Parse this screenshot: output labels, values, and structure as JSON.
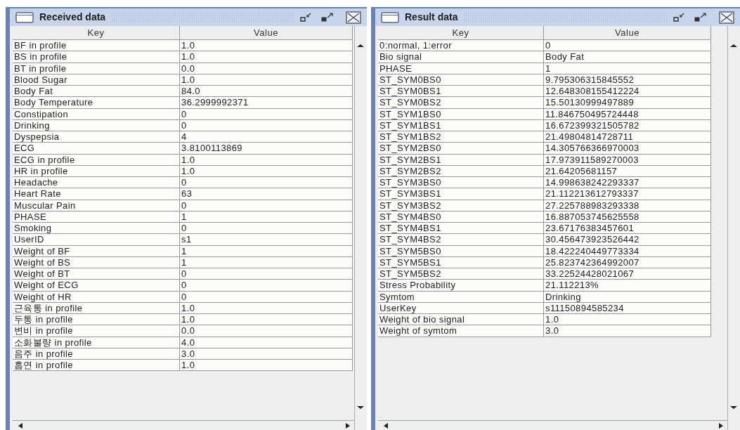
{
  "windows": [
    {
      "title": "Received data",
      "columns": [
        "Key",
        "Value"
      ],
      "rows": [
        {
          "key": "BF in profile",
          "value": "1.0"
        },
        {
          "key": "BS in profile",
          "value": "1.0"
        },
        {
          "key": "BT in profile",
          "value": "0.0"
        },
        {
          "key": "Blood Sugar",
          "value": "1.0"
        },
        {
          "key": "Body Fat",
          "value": "84.0"
        },
        {
          "key": "Body Temperature",
          "value": "36.2999992371"
        },
        {
          "key": "Constipation",
          "value": "0"
        },
        {
          "key": "Drinking",
          "value": "0"
        },
        {
          "key": "Dyspepsia",
          "value": "4"
        },
        {
          "key": "ECG",
          "value": "3.8100113869"
        },
        {
          "key": "ECG in profile",
          "value": "1.0"
        },
        {
          "key": "HR in profile",
          "value": "1.0"
        },
        {
          "key": "Headache",
          "value": "0"
        },
        {
          "key": "Heart Rate",
          "value": "63"
        },
        {
          "key": "Muscular Pain",
          "value": "0"
        },
        {
          "key": "PHASE",
          "value": "1"
        },
        {
          "key": "Smoking",
          "value": "0"
        },
        {
          "key": "UserID",
          "value": "s1"
        },
        {
          "key": "Weight of BF",
          "value": "1"
        },
        {
          "key": "Weight of BS",
          "value": "1"
        },
        {
          "key": "Weight of BT",
          "value": "0"
        },
        {
          "key": "Weight of ECG",
          "value": "0"
        },
        {
          "key": "Weight of HR",
          "value": "0"
        },
        {
          "key": "근육통 in profile",
          "value": "1.0"
        },
        {
          "key": "두통 in profile",
          "value": "1.0"
        },
        {
          "key": "변비 in profile",
          "value": "0.0"
        },
        {
          "key": "소화불량 in profile",
          "value": "4.0"
        },
        {
          "key": "음주 in profile",
          "value": "3.0"
        },
        {
          "key": "흡연 in profile",
          "value": "1.0"
        }
      ]
    },
    {
      "title": "Result data",
      "columns": [
        "Key",
        "Value"
      ],
      "rows": [
        {
          "key": "0:normal, 1:error",
          "value": "0"
        },
        {
          "key": "Bio signal",
          "value": "Body Fat"
        },
        {
          "key": "PHASE",
          "value": "1"
        },
        {
          "key": "ST_SYM0BS0",
          "value": "9.795306315845552"
        },
        {
          "key": "ST_SYM0BS1",
          "value": "12.648308155412224"
        },
        {
          "key": "ST_SYM0BS2",
          "value": "15.50130999497889"
        },
        {
          "key": "ST_SYM1BS0",
          "value": "11.846750495724448"
        },
        {
          "key": "ST_SYM1BS1",
          "value": "16.672399321505782"
        },
        {
          "key": "ST_SYM1BS2",
          "value": "21.49804814728711"
        },
        {
          "key": "ST_SYM2BS0",
          "value": "14.305766366970003"
        },
        {
          "key": "ST_SYM2BS1",
          "value": "17.973911589270003"
        },
        {
          "key": "ST_SYM2BS2",
          "value": "21.64205681157"
        },
        {
          "key": "ST_SYM3BS0",
          "value": "14.998638242293337"
        },
        {
          "key": "ST_SYM3BS1",
          "value": "21.112213612793337"
        },
        {
          "key": "ST_SYM3BS2",
          "value": "27.225788983293338"
        },
        {
          "key": "ST_SYM4BS0",
          "value": "16.887053745625558"
        },
        {
          "key": "ST_SYM4BS1",
          "value": "23.67176383457601"
        },
        {
          "key": "ST_SYM4BS2",
          "value": "30.456473923526442"
        },
        {
          "key": "ST_SYM5BS0",
          "value": "18.422240449773334"
        },
        {
          "key": "ST_SYM5BS1",
          "value": "25.823742364992007"
        },
        {
          "key": "ST_SYM5BS2",
          "value": "33.22524428021067"
        },
        {
          "key": "Stress Probability",
          "value": "21.112213%"
        },
        {
          "key": "Symtom",
          "value": "Drinking"
        },
        {
          "key": "UserKey",
          "value": "s11150894585234"
        },
        {
          "key": "Weight of bio signal",
          "value": "1.0"
        },
        {
          "key": "Weight of symtom",
          "value": "3.0"
        }
      ]
    }
  ]
}
